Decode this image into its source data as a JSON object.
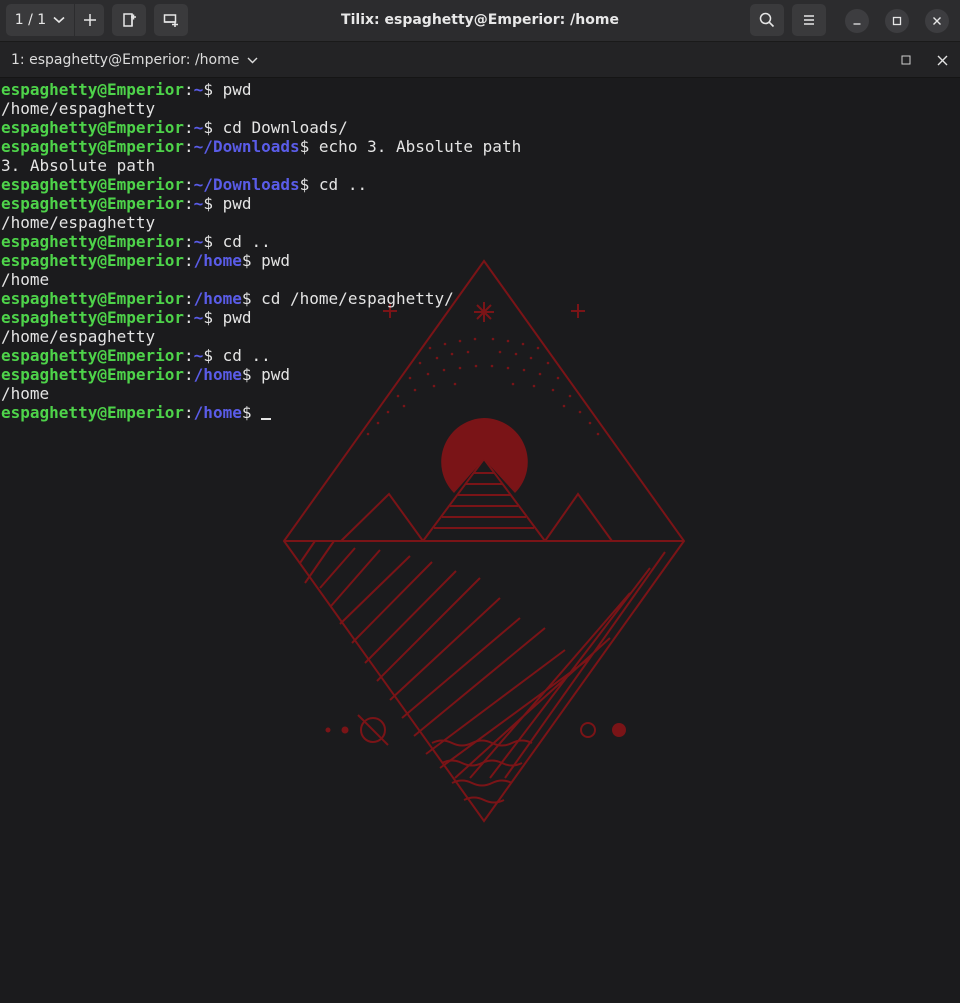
{
  "titlebar": {
    "session_label": "1 / 1",
    "window_title": "Tilix: espaghetty@Emperior: /home"
  },
  "terminal_header": {
    "title": "1: espaghetty@Emperior: /home"
  },
  "colors": {
    "user_host": "#4ed34a",
    "path": "#5a5ce8",
    "background": "#1b1b1d",
    "art": "#7a1417"
  },
  "prompt": {
    "user_host": "espaghetty@Emperior",
    "colon": ":"
  },
  "lines": [
    {
      "type": "prompt",
      "path": "~",
      "cmd": " pwd"
    },
    {
      "type": "output",
      "text": "/home/espaghetty"
    },
    {
      "type": "prompt",
      "path": "~",
      "cmd": " cd Downloads/"
    },
    {
      "type": "prompt",
      "path": "~/Downloads",
      "cmd": " echo 3. Absolute path"
    },
    {
      "type": "output",
      "text": "3. Absolute path"
    },
    {
      "type": "prompt",
      "path": "~/Downloads",
      "cmd": " cd .."
    },
    {
      "type": "prompt",
      "path": "~",
      "cmd": " pwd"
    },
    {
      "type": "output",
      "text": "/home/espaghetty"
    },
    {
      "type": "prompt",
      "path": "~",
      "cmd": " cd .."
    },
    {
      "type": "prompt",
      "path": "/home",
      "cmd": " pwd"
    },
    {
      "type": "output",
      "text": "/home"
    },
    {
      "type": "prompt",
      "path": "/home",
      "cmd": " cd /home/espaghetty/"
    },
    {
      "type": "prompt",
      "path": "~",
      "cmd": " pwd"
    },
    {
      "type": "output",
      "text": "/home/espaghetty"
    },
    {
      "type": "prompt",
      "path": "~",
      "cmd": " cd .."
    },
    {
      "type": "prompt",
      "path": "/home",
      "cmd": " pwd"
    },
    {
      "type": "output",
      "text": "/home"
    },
    {
      "type": "prompt",
      "path": "/home",
      "cmd": " ",
      "cursor": true
    }
  ],
  "icons": {
    "session_dropdown": "chevron-down-icon",
    "add_terminal": "plus-icon",
    "add_right": "add-terminal-right-icon",
    "add_down": "add-terminal-down-icon",
    "search": "search-icon",
    "menu": "hamburger-menu-icon",
    "minimize": "minimize-icon",
    "maximize": "maximize-icon",
    "close": "close-icon"
  }
}
